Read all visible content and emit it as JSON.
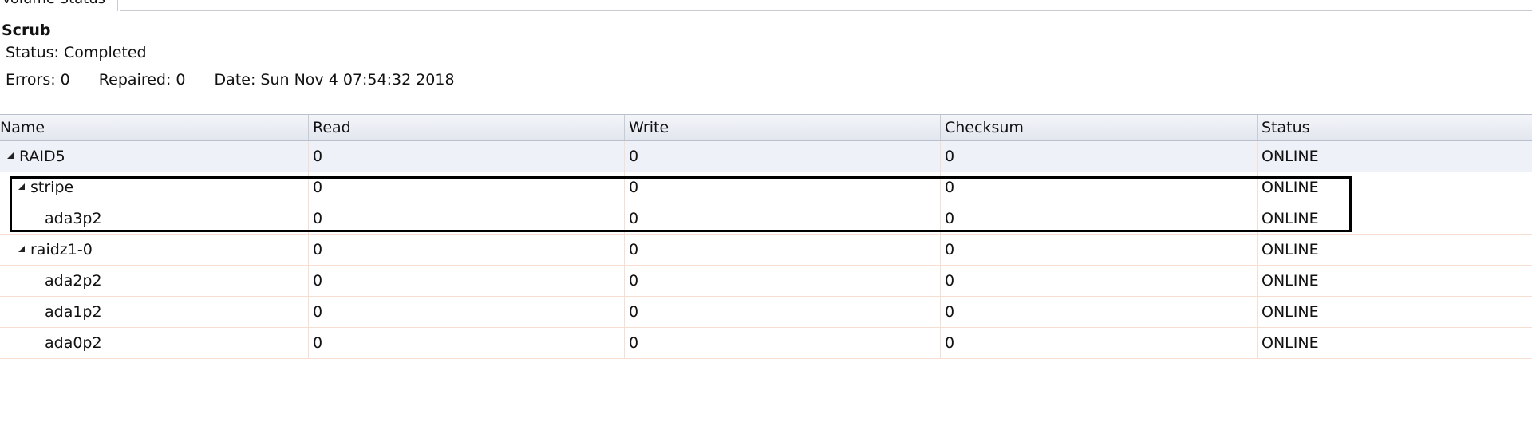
{
  "tab": {
    "label": "Volume Status"
  },
  "scrub": {
    "title": "Scrub",
    "status": "Status: Completed",
    "errors": "Errors: 0",
    "repaired": "Repaired: 0",
    "date": "Date: Sun Nov 4 07:54:32 2018"
  },
  "grid": {
    "columns": [
      "Name",
      "Read",
      "Write",
      "Checksum",
      "Status"
    ],
    "rows": [
      {
        "name": "RAID5",
        "read": "0",
        "write": "0",
        "checksum": "0",
        "status": "ONLINE",
        "level": 0,
        "expandable": true
      },
      {
        "name": "stripe",
        "read": "0",
        "write": "0",
        "checksum": "0",
        "status": "ONLINE",
        "level": 1,
        "expandable": true
      },
      {
        "name": "ada3p2",
        "read": "0",
        "write": "0",
        "checksum": "0",
        "status": "ONLINE",
        "level": 2,
        "expandable": false
      },
      {
        "name": "raidz1-0",
        "read": "0",
        "write": "0",
        "checksum": "0",
        "status": "ONLINE",
        "level": 1,
        "expandable": true
      },
      {
        "name": "ada2p2",
        "read": "0",
        "write": "0",
        "checksum": "0",
        "status": "ONLINE",
        "level": 2,
        "expandable": false
      },
      {
        "name": "ada1p2",
        "read": "0",
        "write": "0",
        "checksum": "0",
        "status": "ONLINE",
        "level": 2,
        "expandable": false
      },
      {
        "name": "ada0p2",
        "read": "0",
        "write": "0",
        "checksum": "0",
        "status": "ONLINE",
        "level": 2,
        "expandable": false
      }
    ]
  },
  "colors": {
    "header_bg": "#e6e9f0",
    "row_border": "#f6dfd2",
    "selected_row": "#eef1f8",
    "highlight": "#000000"
  },
  "icons": {
    "expand": "triangle-expanded-icon"
  }
}
